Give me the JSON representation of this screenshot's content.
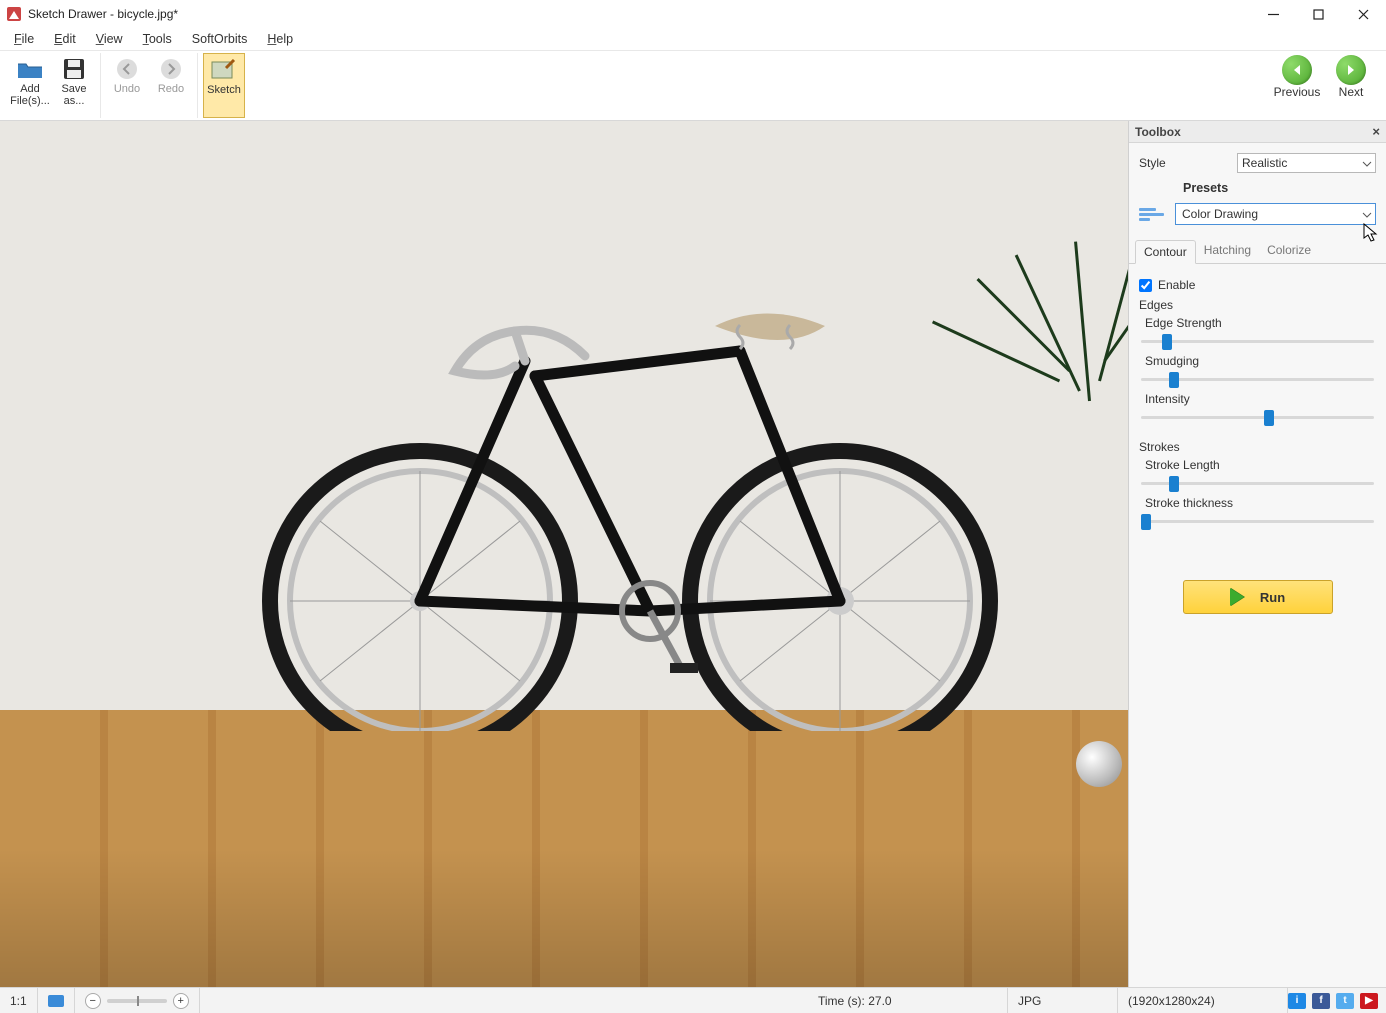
{
  "window": {
    "title": "Sketch Drawer - bicycle.jpg*"
  },
  "menu": {
    "file": "File",
    "edit": "Edit",
    "view": "View",
    "tools": "Tools",
    "softorbits": "SoftOrbits",
    "help": "Help"
  },
  "toolbar": {
    "add": "Add File(s)...",
    "save": "Save as...",
    "undo": "Undo",
    "redo": "Redo",
    "sketch": "Sketch",
    "previous": "Previous",
    "next": "Next"
  },
  "toolbox": {
    "title": "Toolbox",
    "style_label": "Style",
    "style_value": "Realistic",
    "presets_label": "Presets",
    "presets_value": "Color Drawing",
    "tabs": {
      "contour": "Contour",
      "hatching": "Hatching",
      "colorize": "Colorize"
    },
    "enable": "Enable",
    "edges_title": "Edges",
    "edge_strength": "Edge Strength",
    "smudging": "Smudging",
    "intensity": "Intensity",
    "strokes_title": "Strokes",
    "stroke_length": "Stroke Length",
    "stroke_thickness": "Stroke thickness",
    "run": "Run",
    "sliders": {
      "edge_strength_pct": 11,
      "smudging_pct": 14,
      "intensity_pct": 55,
      "stroke_length_pct": 14,
      "stroke_thickness_pct": 2
    }
  },
  "status": {
    "zoom_ratio": "1:1",
    "time": "Time (s): 27.0",
    "format": "JPG",
    "dimensions": "(1920x1280x24)"
  }
}
